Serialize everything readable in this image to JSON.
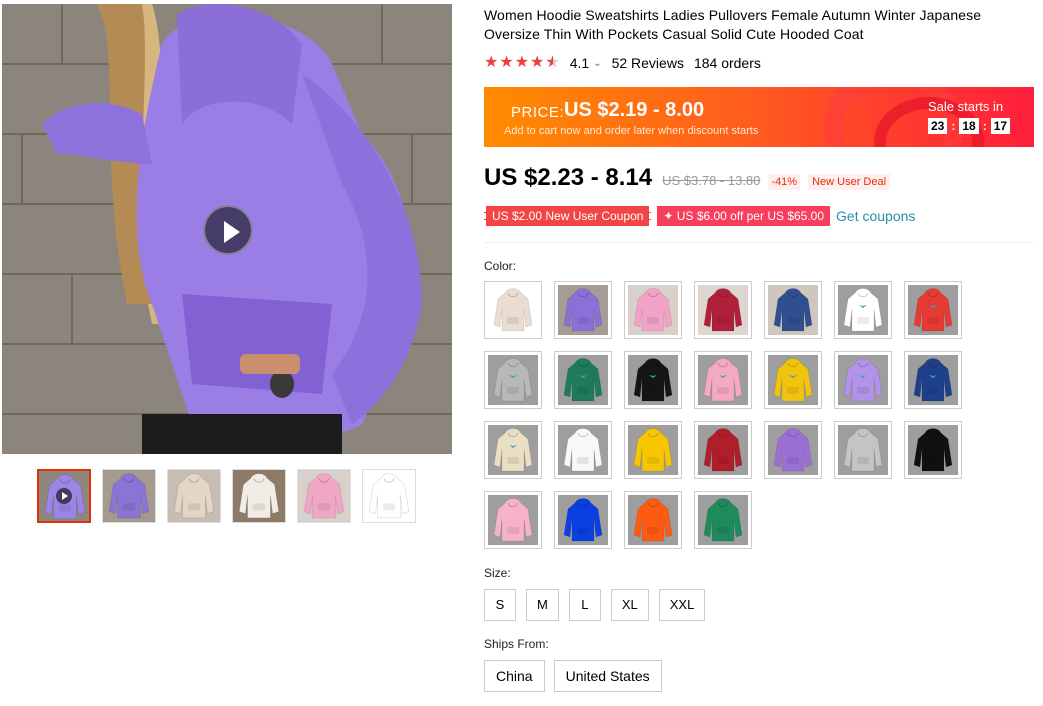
{
  "product": {
    "title": "Women Hoodie Sweatshirts Ladies Pullovers Female Autumn Winter Japanese Oversize Thin With Pockets Casual Solid Cute Hooded Coat",
    "rating_value": "4.1",
    "rating_stars": 4.1,
    "reviews": "52 Reviews",
    "orders": "184 orders"
  },
  "promo": {
    "price_label": "PRICE:",
    "price_value": "US $2.19 - 8.00",
    "subtitle": "Add to cart now and order later when discount starts",
    "sale_label": "Sale starts in",
    "countdown": {
      "hours": "23",
      "minutes": "18",
      "seconds": "17"
    },
    "sep": ":"
  },
  "price": {
    "current": "US $2.23 - 8.14",
    "original": "US $3.78 - 13.80",
    "discount": "-41%",
    "deal_badge": "New User Deal"
  },
  "coupons": {
    "new_user": "US $2.00 New User Coupon",
    "store": "✦ US $6.00 off per US $65.00",
    "get_label": "Get coupons"
  },
  "color": {
    "label": "Color:",
    "swatches": [
      {
        "body": "#e9ddd2",
        "bg": "#ffffff",
        "logo": false
      },
      {
        "body": "#8a70d8",
        "bg": "#a79c94",
        "logo": false
      },
      {
        "body": "#f2a2c6",
        "bg": "#d9d0cc",
        "logo": false
      },
      {
        "body": "#b0203a",
        "bg": "#ddd6d0",
        "logo": false
      },
      {
        "body": "#2f4f8f",
        "bg": "#cfc6be",
        "logo": false
      },
      {
        "body": "#ffffff",
        "bg": "#9e9e9e",
        "logo": true
      },
      {
        "body": "#e63a34",
        "bg": "#9e9e9e",
        "logo": true
      },
      {
        "body": "#b8b8b8",
        "bg": "#9e9e9e",
        "logo": true
      },
      {
        "body": "#1f7a5a",
        "bg": "#9e9e9e",
        "logo": true
      },
      {
        "body": "#151515",
        "bg": "#9e9e9e",
        "logo": true
      },
      {
        "body": "#f4a9c3",
        "bg": "#9e9e9e",
        "logo": true
      },
      {
        "body": "#f1c40f",
        "bg": "#9e9e9e",
        "logo": true
      },
      {
        "body": "#b193e8",
        "bg": "#9e9e9e",
        "logo": true
      },
      {
        "body": "#1e3f8a",
        "bg": "#9e9e9e",
        "logo": true
      },
      {
        "body": "#eadfc5",
        "bg": "#9e9e9e",
        "logo": true
      },
      {
        "body": "#f8f8f8",
        "bg": "#9e9e9e",
        "logo": false
      },
      {
        "body": "#f7c600",
        "bg": "#9e9e9e",
        "logo": false
      },
      {
        "body": "#b01e2c",
        "bg": "#9e9e9e",
        "logo": false
      },
      {
        "body": "#9b6fd6",
        "bg": "#9e9e9e",
        "logo": false
      },
      {
        "body": "#c4c4c4",
        "bg": "#9e9e9e",
        "logo": false
      },
      {
        "body": "#111111",
        "bg": "#9e9e9e",
        "logo": false
      },
      {
        "body": "#f5b2c8",
        "bg": "#9e9e9e",
        "logo": false
      },
      {
        "body": "#0a3fe0",
        "bg": "#9e9e9e",
        "logo": false
      },
      {
        "body": "#ff5a14",
        "bg": "#9e9e9e",
        "logo": false
      },
      {
        "body": "#1f8a5c",
        "bg": "#9e9e9e",
        "logo": false
      }
    ]
  },
  "size": {
    "label": "Size:",
    "options": [
      "S",
      "M",
      "L",
      "XL",
      "XXL"
    ]
  },
  "ships": {
    "label": "Ships From:",
    "options": [
      "China",
      "United States"
    ]
  },
  "gallery": {
    "thumbnails": [
      {
        "body": "#9b86e8",
        "bg": "#8d8780",
        "video": true
      },
      {
        "body": "#8a74d6",
        "bg": "#a59a90",
        "video": false
      },
      {
        "body": "#e4d6c6",
        "bg": "#c6bdb3",
        "video": false
      },
      {
        "body": "#f1ece6",
        "bg": "#8e7a66",
        "video": false
      },
      {
        "body": "#f1a6c6",
        "bg": "#d8d0ca",
        "video": false
      },
      {
        "body": "#ffffff",
        "bg": "#ffffff",
        "video": false
      }
    ]
  }
}
